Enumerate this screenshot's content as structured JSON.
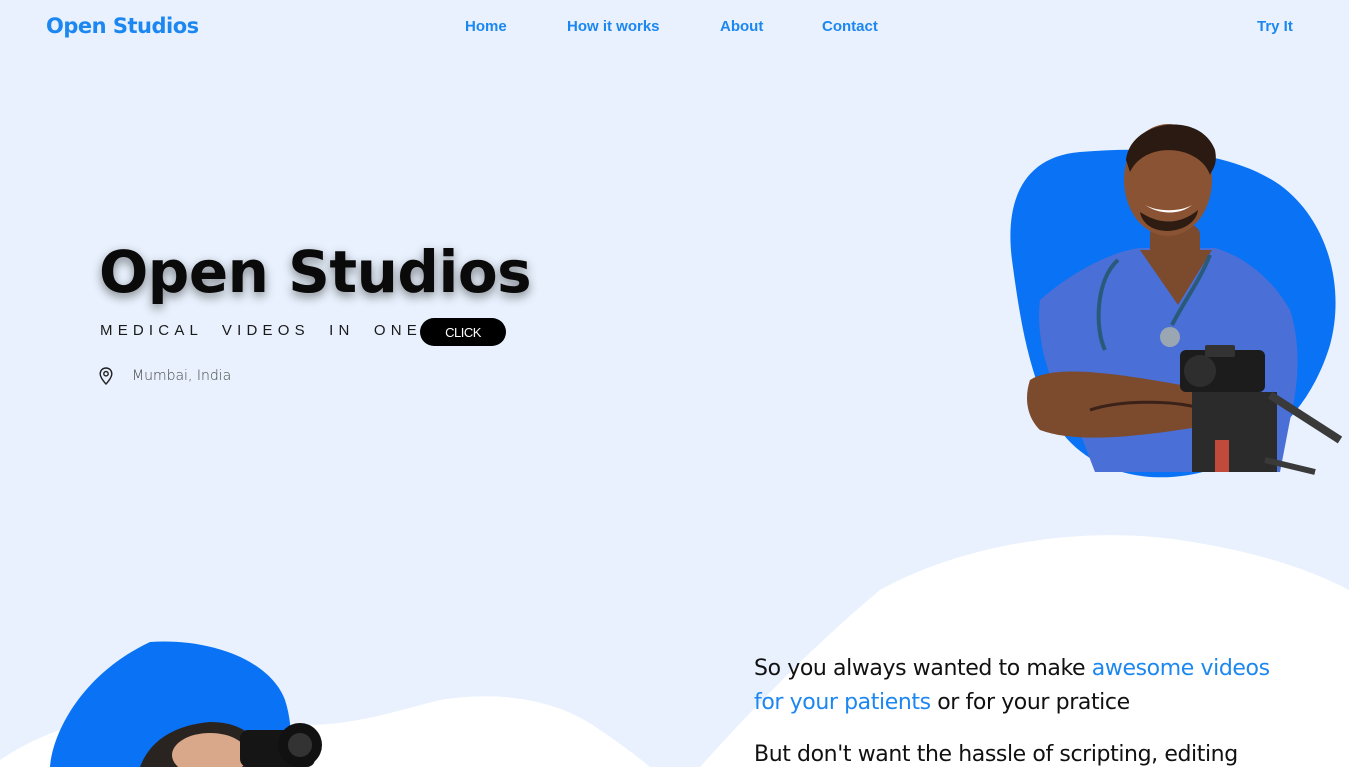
{
  "header": {
    "logo": "Open Studios",
    "nav": {
      "home": "Home",
      "how": "How it works",
      "about": "About",
      "contact": "Contact",
      "try": "Try It"
    }
  },
  "hero": {
    "title": "Open Studios",
    "tagline": "MEDICAL VIDEOS IN ONE",
    "cta_label": "CLICK",
    "location": "Mumbai, India"
  },
  "intro": {
    "p1_before": "So you always wanted to make ",
    "p1_highlight": "awesome videos for your patients",
    "p1_after": " or for your pratice",
    "p2": "But don't want the hassle of scripting, editing"
  },
  "colors": {
    "background": "#e8f1fd",
    "accent": "#1c87f0",
    "blob": "#0a72f5"
  },
  "icons": {
    "location": "map-pin-icon"
  }
}
